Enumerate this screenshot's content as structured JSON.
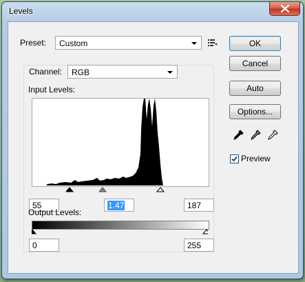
{
  "window": {
    "title": "Levels"
  },
  "preset": {
    "label": "Preset:",
    "value": "Custom"
  },
  "channel": {
    "label": "Channel:",
    "value": "RGB"
  },
  "input_levels": {
    "label": "Input Levels:",
    "black": "55",
    "gamma": "1.47",
    "white": "187"
  },
  "output_levels": {
    "label": "Output Levels:",
    "black": "0",
    "white": "255"
  },
  "buttons": {
    "ok": "OK",
    "cancel": "Cancel",
    "auto": "Auto",
    "options": "Options..."
  },
  "preview": {
    "label": "Preview",
    "checked": true
  },
  "icons": [
    "close-icon",
    "preset-menu-icon",
    "black-eyedropper-icon",
    "gray-eyedropper-icon",
    "white-eyedropper-icon"
  ]
}
